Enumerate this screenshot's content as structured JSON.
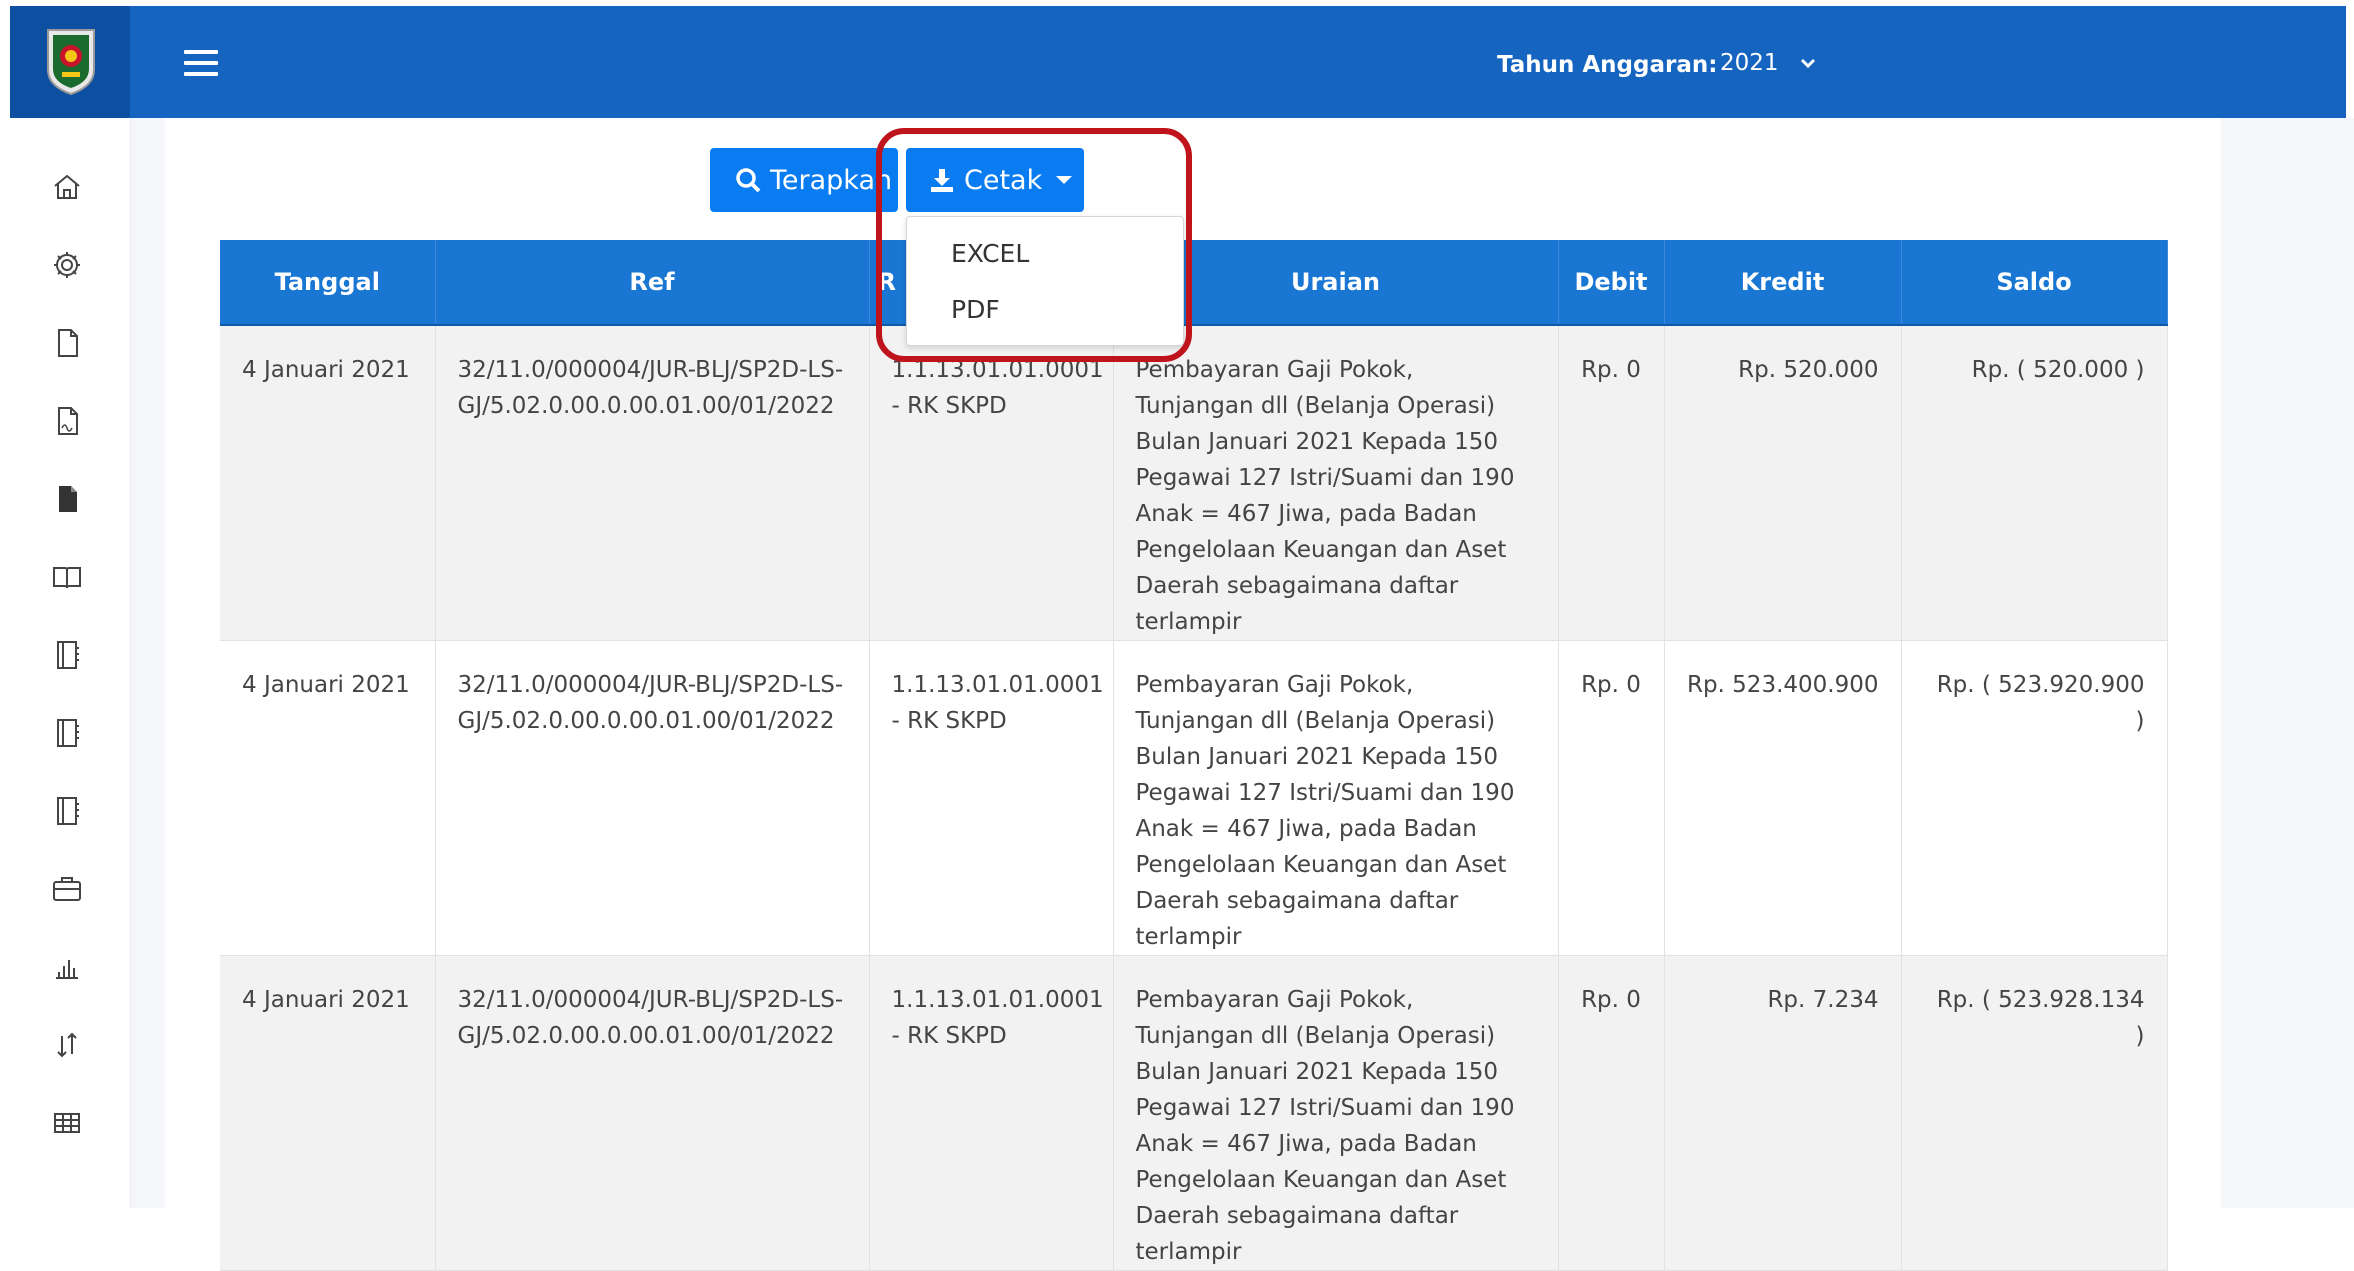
{
  "header": {
    "budget_year_label": "Tahun Anggaran:",
    "budget_year_value": "2021",
    "brand_color": "#1565c0"
  },
  "toolbar": {
    "apply_label": "Terapkan",
    "print_label": "Cetak",
    "button_color": "#0a7cf2"
  },
  "print_menu": {
    "items": [
      "EXCEL",
      "PDF"
    ],
    "highlight_color": "#c0141c"
  },
  "sidebar": {
    "icons": [
      "home-icon",
      "gear-icon",
      "file-icon",
      "file-signed-icon",
      "file-filled-icon",
      "book-open-icon",
      "notebook-icon",
      "notebook-icon",
      "notebook-icon",
      "briefcase-icon",
      "bar-chart-icon",
      "transfer-arrows-icon",
      "table-icon"
    ]
  },
  "table": {
    "headers": [
      "Tanggal",
      "Ref",
      "R",
      "Uraian",
      "Debit",
      "Kredit",
      "Saldo"
    ],
    "rows": [
      {
        "tanggal": "4 Januari 2021",
        "ref": "32/11.0/000004/JUR-BLJ/SP2D-LS-GJ/5.02.0.00.0.00.01.00/01/2022",
        "rek": "1.1.13.01.01.0001 - RK SKPD",
        "uraian": "Pembayaran Gaji Pokok, Tunjangan dll (Belanja Operasi) Bulan Januari 2021 Kepada 150 Pegawai 127 Istri/Suami dan 190 Anak = 467 Jiwa, pada Badan Pengelolaan Keuangan dan Aset Daerah sebagaimana daftar terlampir",
        "debit": "Rp. 0",
        "kredit": "Rp. 520.000",
        "saldo": "Rp. ( 520.000 )"
      },
      {
        "tanggal": "4 Januari 2021",
        "ref": "32/11.0/000004/JUR-BLJ/SP2D-LS-GJ/5.02.0.00.0.00.01.00/01/2022",
        "rek": "1.1.13.01.01.0001 - RK SKPD",
        "uraian": "Pembayaran Gaji Pokok, Tunjangan dll (Belanja Operasi) Bulan Januari 2021 Kepada 150 Pegawai 127 Istri/Suami dan 190 Anak = 467 Jiwa, pada Badan Pengelolaan Keuangan dan Aset Daerah sebagaimana daftar terlampir",
        "debit": "Rp. 0",
        "kredit": "Rp. 523.400.900",
        "saldo": "Rp. ( 523.920.900 )"
      },
      {
        "tanggal": "4 Januari 2021",
        "ref": "32/11.0/000004/JUR-BLJ/SP2D-LS-GJ/5.02.0.00.0.00.01.00/01/2022",
        "rek": "1.1.13.01.01.0001 - RK SKPD",
        "uraian": "Pembayaran Gaji Pokok, Tunjangan dll (Belanja Operasi) Bulan Januari 2021 Kepada 150 Pegawai 127 Istri/Suami dan 190 Anak = 467 Jiwa, pada Badan Pengelolaan Keuangan dan Aset Daerah sebagaimana daftar terlampir",
        "debit": "Rp. 0",
        "kredit": "Rp. 7.234",
        "saldo": "Rp. ( 523.928.134 )"
      }
    ]
  }
}
